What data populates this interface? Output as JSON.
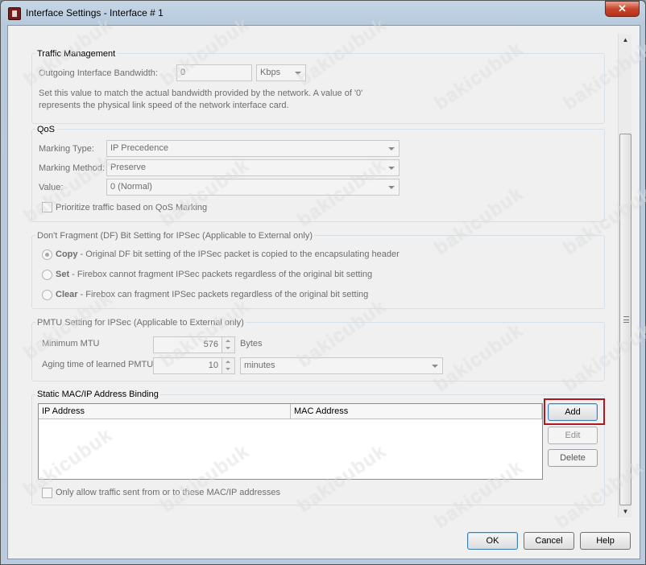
{
  "window": {
    "title": "Interface Settings - Interface # 1",
    "close_label": "✕"
  },
  "traffic": {
    "legend": "Traffic Management",
    "bandwidth_label": "Outgoing Interface Bandwidth:",
    "bandwidth_value": "0",
    "unit_value": "Kbps",
    "desc_line1": "Set this value to match the actual bandwidth provided by the network. A value of '0'",
    "desc_line2": "represents the physical link speed of the network interface card."
  },
  "qos": {
    "legend": "QoS",
    "marking_type_label": "Marking Type:",
    "marking_type_value": "IP Precedence",
    "marking_method_label": "Marking Method:",
    "marking_method_value": "Preserve",
    "value_label": "Value:",
    "value_value": "0 (Normal)",
    "prioritize_label": "Prioritize traffic based on QoS Marking"
  },
  "df": {
    "legend": "Don't Fragment (DF) Bit Setting for IPSec (Applicable to External only)",
    "options": [
      {
        "name": "Copy",
        "desc": " - Original DF bit setting of the IPSec packet is copied to the encapsulating header"
      },
      {
        "name": "Set",
        "desc": " - Firebox cannot fragment IPSec packets regardless of the original bit setting"
      },
      {
        "name": "Clear",
        "desc": " - Firebox can fragment IPSec packets regardless of the original bit setting"
      }
    ]
  },
  "pmtu": {
    "legend": "PMTU Setting for IPSec (Applicable to External only)",
    "min_mtu_label": "Minimum MTU",
    "min_mtu_value": "576",
    "min_mtu_unit": "Bytes",
    "aging_label": "Aging time of learned PMTU",
    "aging_value": "10",
    "aging_unit": "minutes"
  },
  "binding": {
    "legend": "Static MAC/IP Address Binding",
    "columns": [
      "IP Address",
      "MAC Address"
    ],
    "add_label": "Add",
    "edit_label": "Edit",
    "delete_label": "Delete",
    "only_allow_label": "Only allow traffic sent from or to these MAC/IP addresses"
  },
  "footer": {
    "ok_label": "OK",
    "cancel_label": "Cancel",
    "help_label": "Help"
  },
  "watermark": "bakicubuk",
  "colors": {
    "highlight": "#b3161e",
    "close_button": "#c7452b"
  }
}
